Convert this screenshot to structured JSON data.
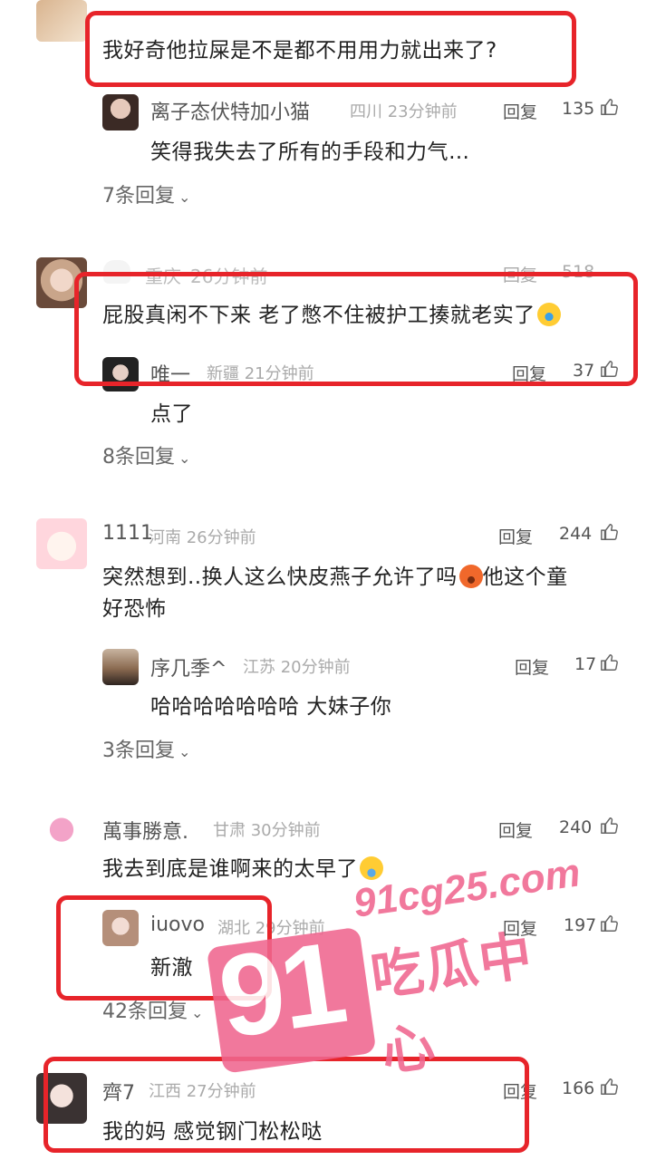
{
  "c0": {
    "text": "我好奇他拉屎是不是都不用用力就出来了?",
    "reply": {
      "name": "离子态伏特加小猫",
      "meta": "四川 23分钟前",
      "reply_label": "回复",
      "likes": "135",
      "text": "笑得我失去了所有的手段和力气…"
    },
    "more": "7条回复"
  },
  "c1": {
    "name": "重庆",
    "meta": "26分钟前",
    "reply_label": "回复",
    "likes": "518",
    "text": "屁股真闲不下来 老了憋不住被护工揍就老实了",
    "reply": {
      "name": "唯一",
      "meta": "新疆 21分钟前",
      "reply_label": "回复",
      "likes": "37",
      "text": "点了"
    },
    "more": "8条回复"
  },
  "c2": {
    "name": "1111",
    "meta": "河南 26分钟前",
    "reply_label": "回复",
    "likes": "244",
    "text_line1": "突然想到..换人这么快皮燕子允许了吗",
    "text_line1b": "他这个童",
    "text_line2": "好恐怖",
    "reply": {
      "name": "序几季^",
      "meta": "江苏 20分钟前",
      "reply_label": "回复",
      "likes": "17",
      "text": "哈哈哈哈哈哈哈 大妹子你"
    },
    "more": "3条回复"
  },
  "c3": {
    "name": "萬事勝意.",
    "meta": "甘肃 30分钟前",
    "reply_label": "回复",
    "likes": "240",
    "text": "我去到底是谁啊来的太早了",
    "reply": {
      "name": "iuovo",
      "meta": "湖北 29分钟前",
      "reply_label": "回复",
      "likes": "197",
      "text": "新澈"
    },
    "more": "42条回复"
  },
  "c4": {
    "name": "齊7",
    "meta": "江西 27分钟前",
    "reply_label": "回复",
    "likes": "166",
    "text": "我的妈 感觉钢门松松哒"
  },
  "watermark": {
    "number": "91",
    "domain": "91cg25.com",
    "title": "吃瓜中心"
  },
  "colors": {
    "highlight": "#e7242a",
    "watermark": "#f0668f"
  }
}
